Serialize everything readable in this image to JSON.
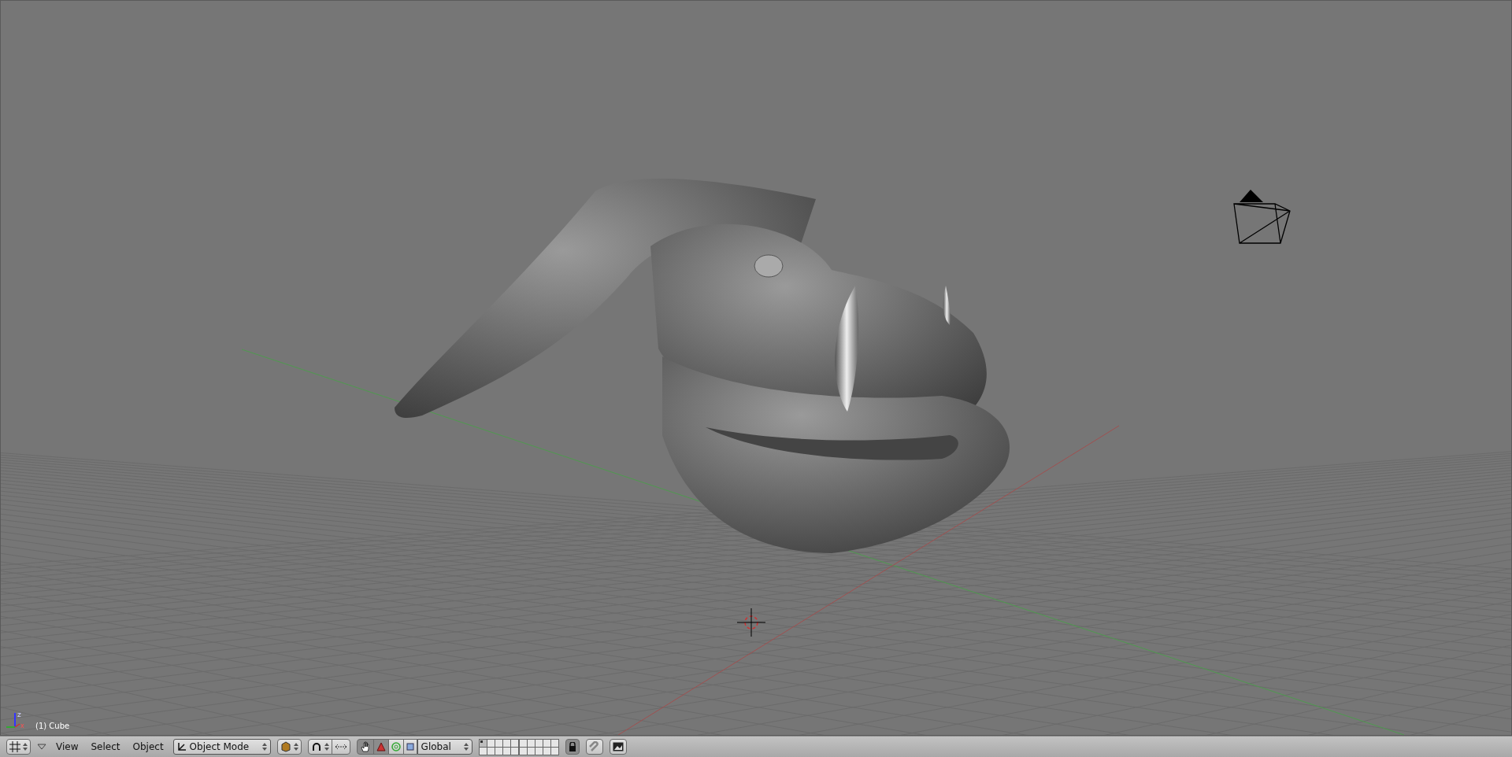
{
  "viewport": {
    "axis_labels": [
      "z",
      "x"
    ],
    "object_label": "(1) Cube"
  },
  "header": {
    "menus": [
      "View",
      "Select",
      "Object"
    ],
    "mode": "Object Mode",
    "manipulators": [
      {
        "kind": "toggle",
        "selected": true
      },
      {
        "kind": "translate",
        "selected": true
      },
      {
        "kind": "rotate",
        "selected": false
      },
      {
        "kind": "scale",
        "selected": false
      }
    ],
    "orientation": "Global",
    "layers": [
      {
        "selected": true
      },
      {
        "selected": false
      },
      {
        "selected": false
      },
      {
        "selected": false
      },
      {
        "selected": false
      },
      {
        "selected": false
      },
      {
        "selected": false
      },
      {
        "selected": false
      },
      {
        "selected": false
      },
      {
        "selected": false
      },
      {
        "selected": false
      },
      {
        "selected": false
      },
      {
        "selected": false
      },
      {
        "selected": false
      },
      {
        "selected": false
      },
      {
        "selected": false
      },
      {
        "selected": false
      },
      {
        "selected": false
      },
      {
        "selected": false
      },
      {
        "selected": false
      }
    ],
    "lock_layers": {
      "on": true
    }
  }
}
